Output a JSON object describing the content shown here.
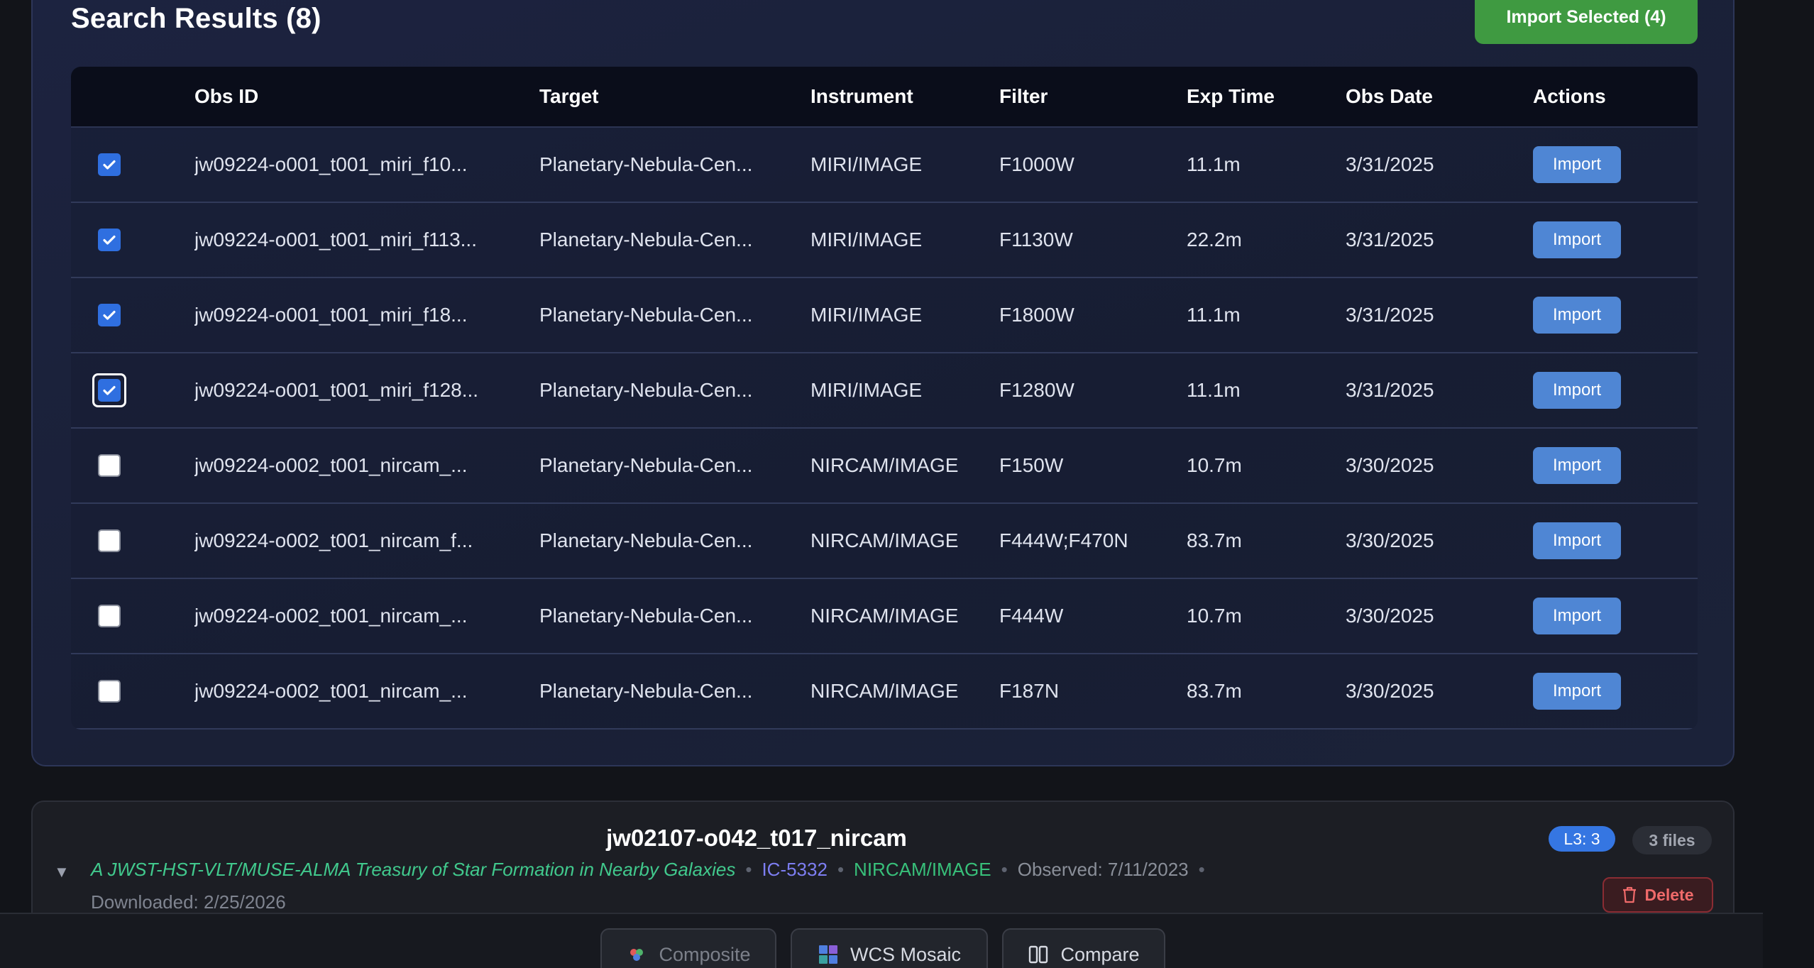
{
  "results": {
    "title": "Search Results (8)",
    "import_selected_label": "Import Selected (4)",
    "columns": [
      "Obs ID",
      "Target",
      "Instrument",
      "Filter",
      "Exp Time",
      "Obs Date",
      "Actions"
    ],
    "rows": [
      {
        "checked": true,
        "obs_id": "jw09224-o001_t001_miri_f10...",
        "target": "Planetary-Nebula-Cen...",
        "instrument": "MIRI/IMAGE",
        "filter": "F1000W",
        "exp_time": "11.1m",
        "obs_date": "3/31/2025",
        "action": "Import"
      },
      {
        "checked": true,
        "obs_id": "jw09224-o001_t001_miri_f113...",
        "target": "Planetary-Nebula-Cen...",
        "instrument": "MIRI/IMAGE",
        "filter": "F1130W",
        "exp_time": "22.2m",
        "obs_date": "3/31/2025",
        "action": "Import"
      },
      {
        "checked": true,
        "obs_id": "jw09224-o001_t001_miri_f18...",
        "target": "Planetary-Nebula-Cen...",
        "instrument": "MIRI/IMAGE",
        "filter": "F1800W",
        "exp_time": "11.1m",
        "obs_date": "3/31/2025",
        "action": "Import"
      },
      {
        "checked": true,
        "obs_id": "jw09224-o001_t001_miri_f128...",
        "target": "Planetary-Nebula-Cen...",
        "instrument": "MIRI/IMAGE",
        "filter": "F1280W",
        "exp_time": "11.1m",
        "obs_date": "3/31/2025",
        "action": "Import"
      },
      {
        "checked": false,
        "obs_id": "jw09224-o002_t001_nircam_...",
        "target": "Planetary-Nebula-Cen...",
        "instrument": "NIRCAM/IMAGE",
        "filter": "F150W",
        "exp_time": "10.7m",
        "obs_date": "3/30/2025",
        "action": "Import"
      },
      {
        "checked": false,
        "obs_id": "jw09224-o002_t001_nircam_f...",
        "target": "Planetary-Nebula-Cen...",
        "instrument": "NIRCAM/IMAGE",
        "filter": "F444W;F470N",
        "exp_time": "83.7m",
        "obs_date": "3/30/2025",
        "action": "Import"
      },
      {
        "checked": false,
        "obs_id": "jw09224-o002_t001_nircam_...",
        "target": "Planetary-Nebula-Cen...",
        "instrument": "NIRCAM/IMAGE",
        "filter": "F444W",
        "exp_time": "10.7m",
        "obs_date": "3/30/2025",
        "action": "Import"
      },
      {
        "checked": false,
        "obs_id": "jw09224-o002_t001_nircam_...",
        "target": "Planetary-Nebula-Cen...",
        "instrument": "NIRCAM/IMAGE",
        "filter": "F187N",
        "exp_time": "83.7m",
        "obs_date": "3/30/2025",
        "action": "Import"
      }
    ]
  },
  "observation": {
    "title": "jw02107-o042_t017_nircam",
    "caret": "▼",
    "proposal": "A JWST-HST-VLT/MUSE-ALMA Treasury of Star Formation in Nearby Galaxies",
    "target": "IC-5332",
    "instrument": "NIRCAM/IMAGE",
    "observed": "Observed: 7/11/2023",
    "downloaded": "Downloaded: 2/25/2026",
    "separator": "•",
    "level_badge": "L3: 3",
    "files_badge": "3 files",
    "delete_label": "Delete"
  },
  "bottom_bar": {
    "composite_label": "Composite",
    "mosaic_label": "WCS Mosaic",
    "compare_label": "Compare"
  },
  "colors": {
    "accent_blue": "#2f6fe0",
    "import_green": "#3f9a41",
    "proposal_green": "#41c98d",
    "target_purple": "#7d7ef2",
    "delete_red": "#f06a6a"
  }
}
